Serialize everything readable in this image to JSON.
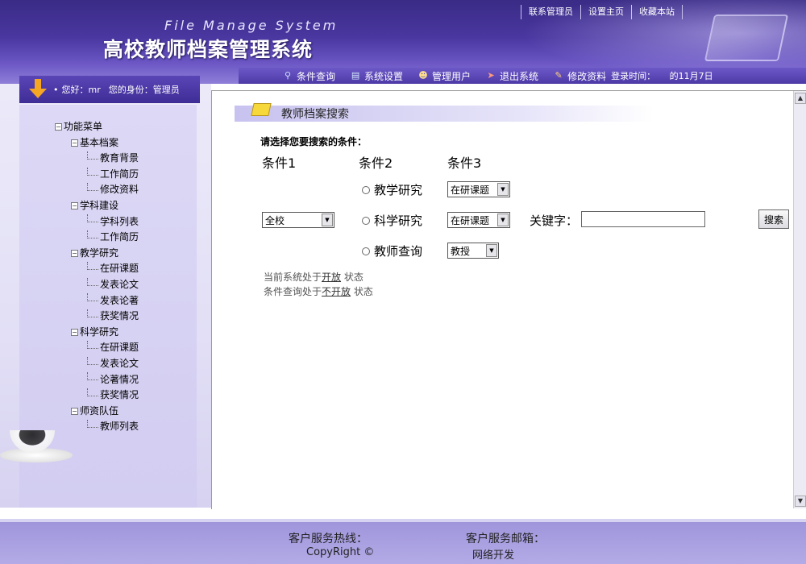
{
  "header": {
    "english_title": "File Manage System",
    "chinese_title": "高校教师档案管理系统",
    "top_links": [
      "联系管理员",
      "设置主页",
      "收藏本站"
    ]
  },
  "nav": {
    "items": [
      {
        "label": "条件查询",
        "icon": "magnifier-icon"
      },
      {
        "label": "系统设置",
        "icon": "computer-settings-icon"
      },
      {
        "label": "管理用户",
        "icon": "users-icon"
      },
      {
        "label": "退出系统",
        "icon": "exit-icon"
      },
      {
        "label": "修改资料",
        "icon": "edit-icon"
      }
    ],
    "login_time": "登录时间：",
    "date_fragment": "的11月7日"
  },
  "user": {
    "greeting": "您好：mr",
    "role": "您的身份：管理员"
  },
  "menu": {
    "root": "功能菜单",
    "groups": [
      {
        "label": "基本档案",
        "items": [
          "教育背景",
          "工作简历",
          "修改资料"
        ]
      },
      {
        "label": "学科建设",
        "items": [
          "学科列表",
          "工作简历"
        ]
      },
      {
        "label": "教学研究",
        "items": [
          "在研课题",
          "发表论文",
          "发表论著",
          "获奖情况"
        ]
      },
      {
        "label": "科学研究",
        "items": [
          "在研课题",
          "发表论文",
          "论著情况",
          "获奖情况"
        ]
      },
      {
        "label": "师资队伍",
        "items": [
          "教师列表"
        ]
      }
    ]
  },
  "search": {
    "section_title": "教师档案搜索",
    "prompt": "请选择您要搜索的条件：",
    "cond1": "条件1",
    "cond2": "条件2",
    "cond3": "条件3",
    "scope_value": "全校",
    "radio_teaching": "教学研究",
    "radio_science": "科学研究",
    "radio_teacher": "教师查询",
    "sel_teaching": "在研课题",
    "sel_science": "在研课题",
    "sel_teacher": "教授",
    "keyword_label": "关键字：",
    "keyword_value": "",
    "search_button": "搜索"
  },
  "status": {
    "line1_prefix": "当前系统处于",
    "line1_value": "开放",
    "line1_suffix": "状态",
    "line2_prefix": "条件查询处于",
    "line2_value": "不开放",
    "line2_suffix": "状态"
  },
  "footer": {
    "hotline": "客户服务热线：",
    "email": "客户服务邮箱：",
    "copyright": "CopyRight ©",
    "network": "网络开发"
  }
}
